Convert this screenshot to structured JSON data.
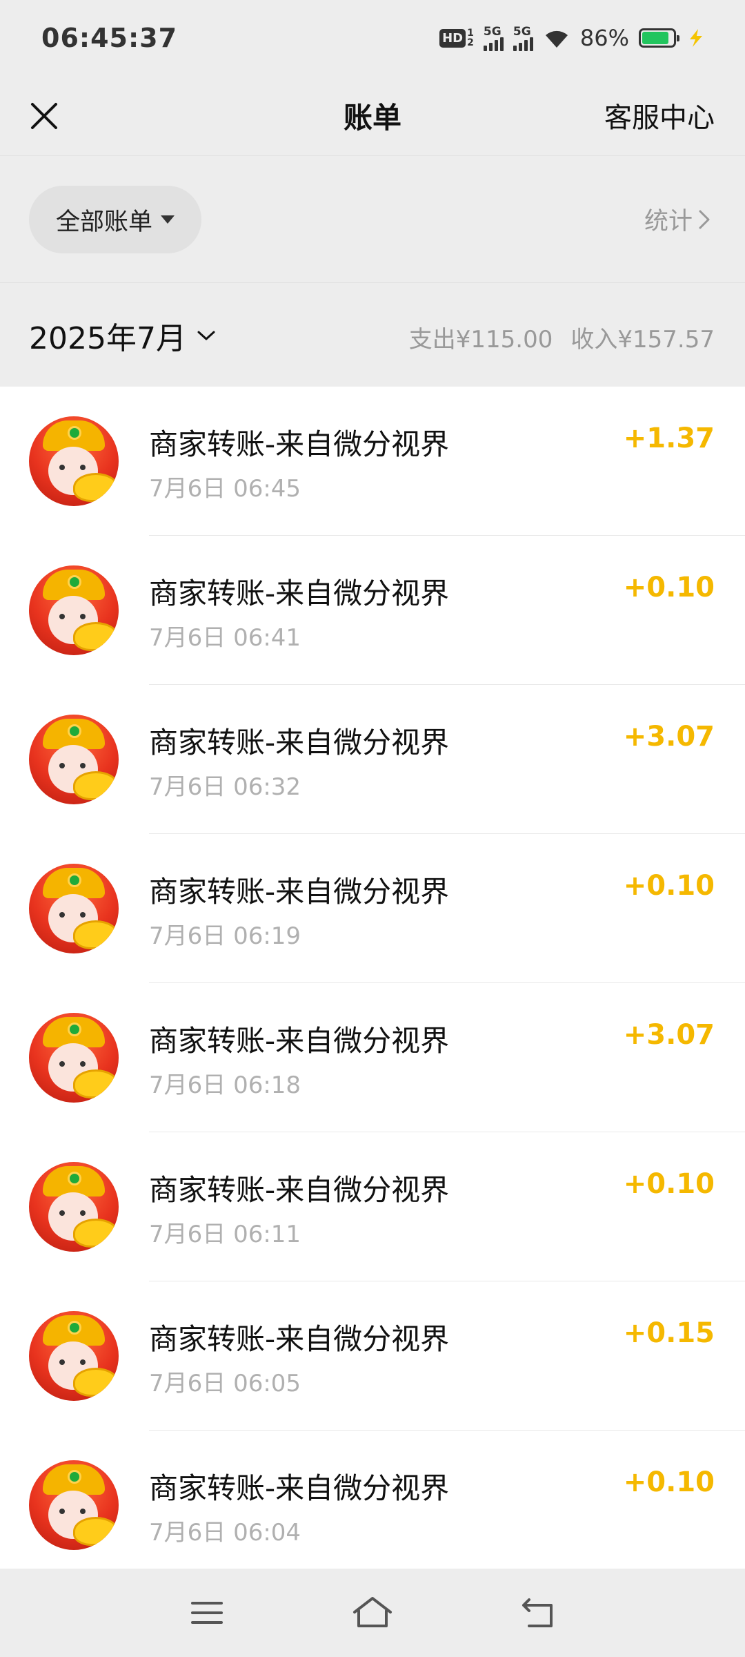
{
  "status": {
    "time": "06:45:37",
    "hd_label": "HD",
    "hd_sub_top": "1",
    "hd_sub_bottom": "2",
    "sim1_label": "5G",
    "sim2_label": "5G",
    "battery_pct": "86%",
    "battery_level": 0.86
  },
  "nav": {
    "close_icon": "close-icon",
    "title": "账单",
    "service": "客服中心"
  },
  "filter": {
    "pill_label": "全部账单",
    "stats_label": "统计"
  },
  "month": {
    "label": "2025年7月",
    "expense": "支出¥115.00",
    "income": "收入¥157.57"
  },
  "transactions": [
    {
      "title": "商家转账-来自微分视界",
      "time": "7月6日 06:45",
      "amount": "+1.37"
    },
    {
      "title": "商家转账-来自微分视界",
      "time": "7月6日 06:41",
      "amount": "+0.10"
    },
    {
      "title": "商家转账-来自微分视界",
      "time": "7月6日 06:32",
      "amount": "+3.07"
    },
    {
      "title": "商家转账-来自微分视界",
      "time": "7月6日 06:19",
      "amount": "+0.10"
    },
    {
      "title": "商家转账-来自微分视界",
      "time": "7月6日 06:18",
      "amount": "+3.07"
    },
    {
      "title": "商家转账-来自微分视界",
      "time": "7月6日 06:11",
      "amount": "+0.10"
    },
    {
      "title": "商家转账-来自微分视界",
      "time": "7月6日 06:05",
      "amount": "+0.15"
    },
    {
      "title": "商家转账-来自微分视界",
      "time": "7月6日 06:04",
      "amount": "+0.10"
    }
  ],
  "colors": {
    "amount": "#f5b800",
    "battery": "#22c55e"
  }
}
